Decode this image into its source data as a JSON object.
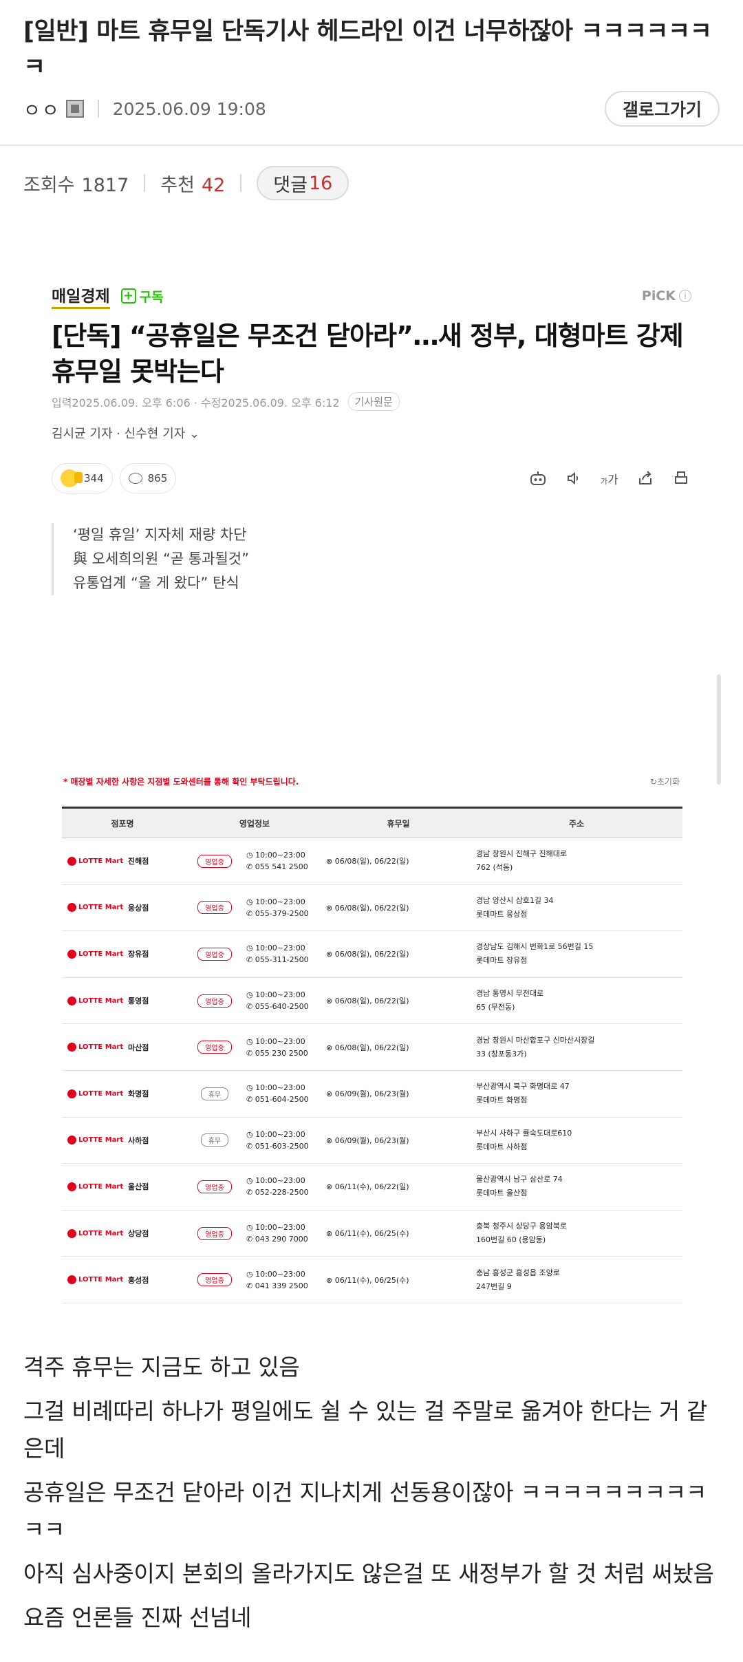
{
  "post": {
    "title": "[일반] 마트 휴무일 단독기사 헤드라인 이건 너무하잖아 ㅋㅋㅋㅋㅋㅋㅋ",
    "author": "ㅇㅇ",
    "date": "2025.06.09 19:08",
    "gallery_button": "갤로그가기",
    "views_label": "조회수",
    "views": "1817",
    "recommend_label": "추천",
    "recommend": "42",
    "comments_label": "댓글",
    "comments": "16"
  },
  "article": {
    "press": "매일경제",
    "subscribe": "구독",
    "pick": "PiCK",
    "headline": "[단독] “공휴일은 무조건 닫아라”…새 정부, 대형마트 강제 휴무일 못박는다",
    "dates": "입력2025.06.09. 오후 6:06 · 수정2025.06.09. 오후 6:12",
    "original_button": "기사원문",
    "reporters": "김시균 기자 · 신수현 기자",
    "reaction_count": "344",
    "comment_count": "865",
    "summary": [
      "‘평일 휴일’ 지자체 재량 차단",
      "與 오세희의원 “곧 통과될것”",
      "유통업계 “올 게 왔다” 탄식"
    ]
  },
  "store_table": {
    "notice": "* 매장별 자세한 사항은 지점별 도와센터를 통해 확인 부탁드립니다.",
    "reset": "초기화",
    "brand": "LOTTE Mart",
    "headers": [
      "점포명",
      "영업정보",
      "휴무일",
      "주소"
    ],
    "rows": [
      {
        "name": "진해점",
        "status": "영업중",
        "hours": "10:00~23:00",
        "phone": "055 541 2500",
        "holiday": "06/08(일), 06/22(일)",
        "addr1": "경남 창원시 진해구 진해대로",
        "addr2": "762 (석동)"
      },
      {
        "name": "웅상점",
        "status": "영업중",
        "hours": "10:00~23:00",
        "phone": "055-379-2500",
        "holiday": "06/08(일), 06/22(일)",
        "addr1": "경남 양산시 삼호1길 34",
        "addr2": "롯데마트 웅상점"
      },
      {
        "name": "장유점",
        "status": "영업중",
        "hours": "10:00~23:00",
        "phone": "055-311-2500",
        "holiday": "06/08(일), 06/22(일)",
        "addr1": "경상남도 김해시 번화1로 56번길 15",
        "addr2": "롯데마트 장유점"
      },
      {
        "name": "통영점",
        "status": "영업중",
        "hours": "10:00~23:00",
        "phone": "055-640-2500",
        "holiday": "06/08(일), 06/22(일)",
        "addr1": "경남 통영시 무전대로",
        "addr2": "65 (무전동)"
      },
      {
        "name": "마산점",
        "status": "영업중",
        "hours": "10:00~23:00",
        "phone": "055 230 2500",
        "holiday": "06/08(일), 06/22(일)",
        "addr1": "경남 창원시 마산합포구 신마산시장길",
        "addr2": "33 (창포동3가)"
      },
      {
        "name": "화명점",
        "status": "휴무",
        "hours": "10:00~23:00",
        "phone": "051-604-2500",
        "holiday": "06/09(월), 06/23(월)",
        "addr1": "부산광역시 북구 화명대로 47",
        "addr2": "롯데마트 화명점"
      },
      {
        "name": "사하점",
        "status": "휴무",
        "hours": "10:00~23:00",
        "phone": "051-603-2500",
        "holiday": "06/09(월), 06/23(월)",
        "addr1": "부산시 사하구 률숙도대로610",
        "addr2": "롯데마트 사하점"
      },
      {
        "name": "울산점",
        "status": "영업중",
        "hours": "10:00~23:00",
        "phone": "052-228-2500",
        "holiday": "06/11(수), 06/22(일)",
        "addr1": "울산광역시 남구 삼산로 74",
        "addr2": "롯데마트 울산점"
      },
      {
        "name": "상당점",
        "status": "영업중",
        "hours": "10:00~23:00",
        "phone": "043 290 7000",
        "holiday": "06/11(수), 06/25(수)",
        "addr1": "충북 청주시 상당구 용암북로",
        "addr2": "160번길 60 (용암동)"
      },
      {
        "name": "홍성점",
        "status": "영업중",
        "hours": "10:00~23:00",
        "phone": "041 339 2500",
        "holiday": "06/11(수), 06/25(수)",
        "addr1": "충남 홍성군 홍성읍 조양로",
        "addr2": "247번길 9"
      }
    ]
  },
  "body": [
    "격주 휴무는 지금도 하고 있음",
    "그걸 비례따리 하나가 평일에도 쉴 수 있는 걸 주말로 옮겨야 한다는 거 같은데",
    "공휴일은 무조건 닫아라 이건 지나치게 선동용이잖아 ㅋㅋㅋㅋㅋㅋㅋㅋㅋㅋㅋ",
    "아직 심사중이지 본회의 올라가지도 않은걸 또 새정부가 할 것 처럼 써놨음",
    "요즘 언론들 진짜 선넘네"
  ]
}
